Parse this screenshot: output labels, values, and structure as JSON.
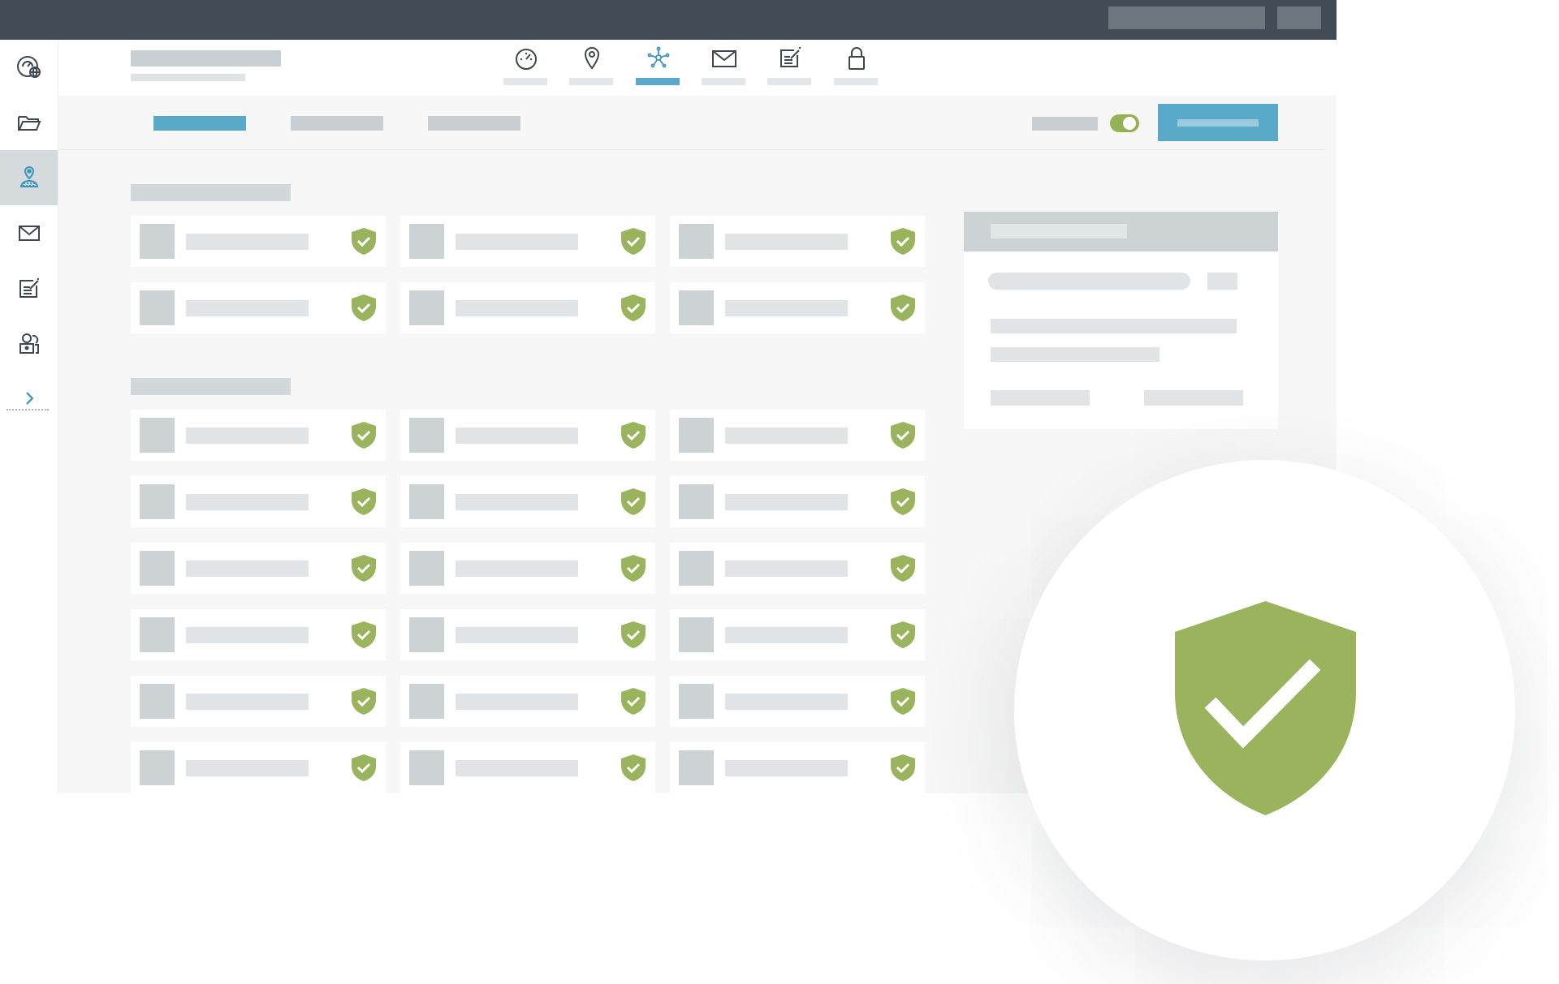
{
  "colors": {
    "topbar": "#414c56",
    "accent": "#5aa9c9",
    "success": "#9ab35d",
    "placeholder_dark": "#cdd2d5",
    "placeholder_light": "#e0e4e6",
    "content_bg": "#f7f7f7"
  },
  "sidebar": {
    "items": [
      {
        "icon": "dashboard-globe-icon",
        "active": false
      },
      {
        "icon": "folder-icon",
        "active": false
      },
      {
        "icon": "location-user-icon",
        "active": true
      },
      {
        "icon": "mail-icon",
        "active": false
      },
      {
        "icon": "edit-note-icon",
        "active": false
      },
      {
        "icon": "users-lock-icon",
        "active": false
      }
    ],
    "expand_icon": "chevron-right-icon"
  },
  "top_nav": {
    "items": [
      {
        "icon": "speedometer-icon",
        "active": false
      },
      {
        "icon": "map-pin-icon",
        "active": false
      },
      {
        "icon": "network-icon",
        "active": true
      },
      {
        "icon": "envelope-icon",
        "active": false
      },
      {
        "icon": "edit-icon",
        "active": false
      },
      {
        "icon": "lock-icon",
        "active": false
      }
    ]
  },
  "toolbar": {
    "toggle_state": "on"
  },
  "sections": [
    {
      "rows": 2,
      "columns": 3,
      "status_icon": "shield-check-icon"
    },
    {
      "rows": 6,
      "columns": 3,
      "status_icon": "shield-check-icon"
    }
  ],
  "badge": {
    "icon": "shield-check-icon"
  }
}
